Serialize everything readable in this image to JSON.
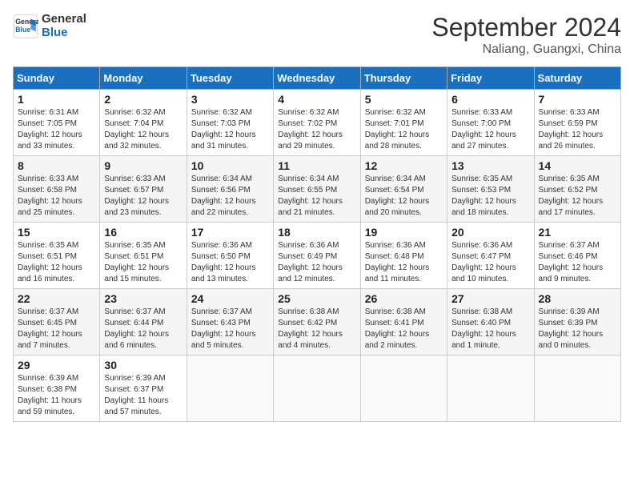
{
  "header": {
    "logo_line1": "General",
    "logo_line2": "Blue",
    "month": "September 2024",
    "location": "Naliang, Guangxi, China"
  },
  "days_of_week": [
    "Sunday",
    "Monday",
    "Tuesday",
    "Wednesday",
    "Thursday",
    "Friday",
    "Saturday"
  ],
  "weeks": [
    [
      {
        "day": "1",
        "info": "Sunrise: 6:31 AM\nSunset: 7:05 PM\nDaylight: 12 hours\nand 33 minutes."
      },
      {
        "day": "2",
        "info": "Sunrise: 6:32 AM\nSunset: 7:04 PM\nDaylight: 12 hours\nand 32 minutes."
      },
      {
        "day": "3",
        "info": "Sunrise: 6:32 AM\nSunset: 7:03 PM\nDaylight: 12 hours\nand 31 minutes."
      },
      {
        "day": "4",
        "info": "Sunrise: 6:32 AM\nSunset: 7:02 PM\nDaylight: 12 hours\nand 29 minutes."
      },
      {
        "day": "5",
        "info": "Sunrise: 6:32 AM\nSunset: 7:01 PM\nDaylight: 12 hours\nand 28 minutes."
      },
      {
        "day": "6",
        "info": "Sunrise: 6:33 AM\nSunset: 7:00 PM\nDaylight: 12 hours\nand 27 minutes."
      },
      {
        "day": "7",
        "info": "Sunrise: 6:33 AM\nSunset: 6:59 PM\nDaylight: 12 hours\nand 26 minutes."
      }
    ],
    [
      {
        "day": "8",
        "info": "Sunrise: 6:33 AM\nSunset: 6:58 PM\nDaylight: 12 hours\nand 25 minutes."
      },
      {
        "day": "9",
        "info": "Sunrise: 6:33 AM\nSunset: 6:57 PM\nDaylight: 12 hours\nand 23 minutes."
      },
      {
        "day": "10",
        "info": "Sunrise: 6:34 AM\nSunset: 6:56 PM\nDaylight: 12 hours\nand 22 minutes."
      },
      {
        "day": "11",
        "info": "Sunrise: 6:34 AM\nSunset: 6:55 PM\nDaylight: 12 hours\nand 21 minutes."
      },
      {
        "day": "12",
        "info": "Sunrise: 6:34 AM\nSunset: 6:54 PM\nDaylight: 12 hours\nand 20 minutes."
      },
      {
        "day": "13",
        "info": "Sunrise: 6:35 AM\nSunset: 6:53 PM\nDaylight: 12 hours\nand 18 minutes."
      },
      {
        "day": "14",
        "info": "Sunrise: 6:35 AM\nSunset: 6:52 PM\nDaylight: 12 hours\nand 17 minutes."
      }
    ],
    [
      {
        "day": "15",
        "info": "Sunrise: 6:35 AM\nSunset: 6:51 PM\nDaylight: 12 hours\nand 16 minutes."
      },
      {
        "day": "16",
        "info": "Sunrise: 6:35 AM\nSunset: 6:51 PM\nDaylight: 12 hours\nand 15 minutes."
      },
      {
        "day": "17",
        "info": "Sunrise: 6:36 AM\nSunset: 6:50 PM\nDaylight: 12 hours\nand 13 minutes."
      },
      {
        "day": "18",
        "info": "Sunrise: 6:36 AM\nSunset: 6:49 PM\nDaylight: 12 hours\nand 12 minutes."
      },
      {
        "day": "19",
        "info": "Sunrise: 6:36 AM\nSunset: 6:48 PM\nDaylight: 12 hours\nand 11 minutes."
      },
      {
        "day": "20",
        "info": "Sunrise: 6:36 AM\nSunset: 6:47 PM\nDaylight: 12 hours\nand 10 minutes."
      },
      {
        "day": "21",
        "info": "Sunrise: 6:37 AM\nSunset: 6:46 PM\nDaylight: 12 hours\nand 9 minutes."
      }
    ],
    [
      {
        "day": "22",
        "info": "Sunrise: 6:37 AM\nSunset: 6:45 PM\nDaylight: 12 hours\nand 7 minutes."
      },
      {
        "day": "23",
        "info": "Sunrise: 6:37 AM\nSunset: 6:44 PM\nDaylight: 12 hours\nand 6 minutes."
      },
      {
        "day": "24",
        "info": "Sunrise: 6:37 AM\nSunset: 6:43 PM\nDaylight: 12 hours\nand 5 minutes."
      },
      {
        "day": "25",
        "info": "Sunrise: 6:38 AM\nSunset: 6:42 PM\nDaylight: 12 hours\nand 4 minutes."
      },
      {
        "day": "26",
        "info": "Sunrise: 6:38 AM\nSunset: 6:41 PM\nDaylight: 12 hours\nand 2 minutes."
      },
      {
        "day": "27",
        "info": "Sunrise: 6:38 AM\nSunset: 6:40 PM\nDaylight: 12 hours\nand 1 minute."
      },
      {
        "day": "28",
        "info": "Sunrise: 6:39 AM\nSunset: 6:39 PM\nDaylight: 12 hours\nand 0 minutes."
      }
    ],
    [
      {
        "day": "29",
        "info": "Sunrise: 6:39 AM\nSunset: 6:38 PM\nDaylight: 11 hours\nand 59 minutes."
      },
      {
        "day": "30",
        "info": "Sunrise: 6:39 AM\nSunset: 6:37 PM\nDaylight: 11 hours\nand 57 minutes."
      },
      {
        "day": "",
        "info": ""
      },
      {
        "day": "",
        "info": ""
      },
      {
        "day": "",
        "info": ""
      },
      {
        "day": "",
        "info": ""
      },
      {
        "day": "",
        "info": ""
      }
    ]
  ]
}
